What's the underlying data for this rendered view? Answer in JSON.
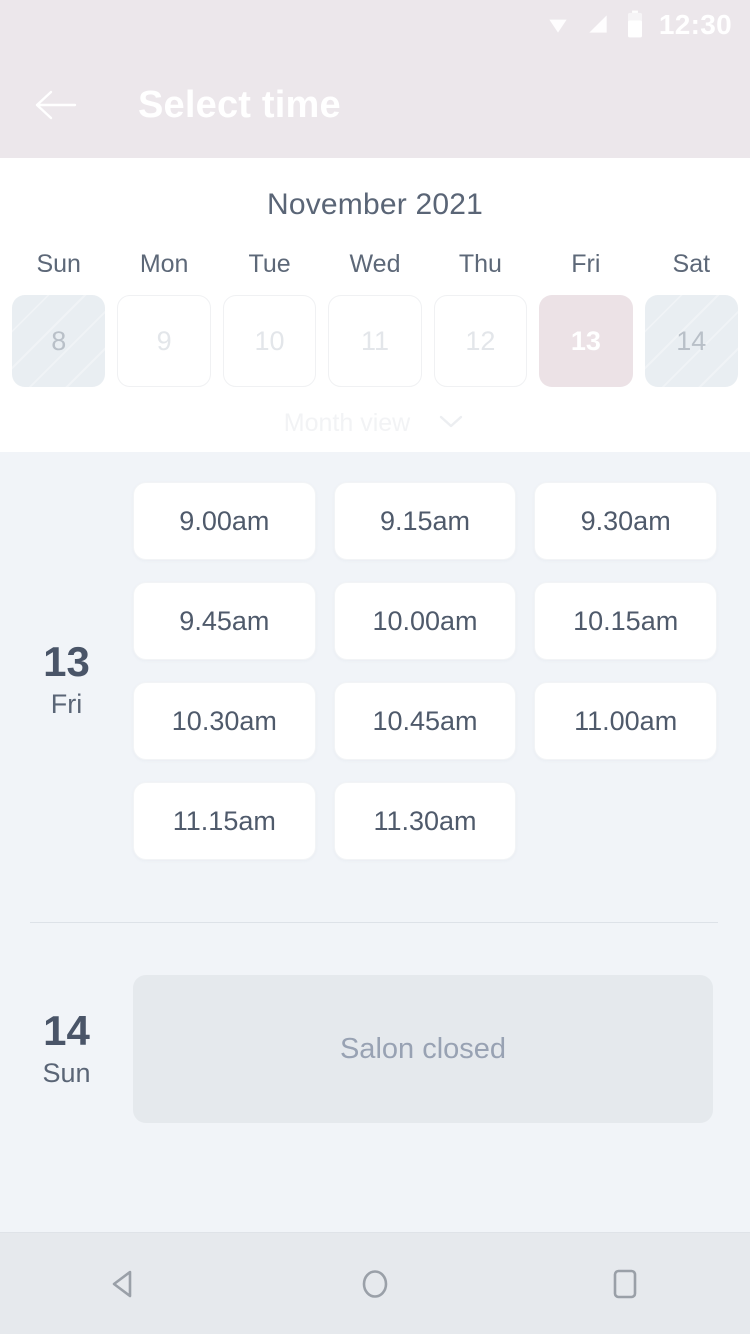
{
  "statusbar": {
    "time": "12:30",
    "icons": [
      "wifi-icon",
      "cellular-signal-icon",
      "battery-icon"
    ]
  },
  "appbar": {
    "back_label": "back-arrow",
    "title": "Select time"
  },
  "calendar": {
    "month_title": "November 2021",
    "weekdays": [
      "Sun",
      "Mon",
      "Tue",
      "Wed",
      "Thu",
      "Fri",
      "Sat"
    ],
    "days": [
      {
        "num": "8",
        "state": "disabled"
      },
      {
        "num": "9",
        "state": "open"
      },
      {
        "num": "10",
        "state": "open"
      },
      {
        "num": "11",
        "state": "open"
      },
      {
        "num": "12",
        "state": "open"
      },
      {
        "num": "13",
        "state": "selected"
      },
      {
        "num": "14",
        "state": "disabled"
      }
    ],
    "month_view_label": "Month view",
    "month_view_icon": "chevron-down-icon"
  },
  "slots": {
    "day1": {
      "num": "13",
      "dow": "Fri",
      "times": [
        "9.00am",
        "9.15am",
        "9.30am",
        "9.45am",
        "10.00am",
        "10.15am",
        "10.30am",
        "10.45am",
        "11.00am",
        "11.15am",
        "11.30am"
      ]
    },
    "day2": {
      "num": "14",
      "dow": "Sun",
      "closed_label": "Salon closed"
    }
  },
  "navbar": {
    "back": "android-back-icon",
    "home": "android-home-icon",
    "recents": "android-recents-icon"
  },
  "colors": {
    "header_bg": "#ece7eb",
    "selected_day_bg": "#ece2e6",
    "slots_bg": "#f1f4f8",
    "text_dark": "#4a5568",
    "closed_bg": "#e5e9ed"
  }
}
